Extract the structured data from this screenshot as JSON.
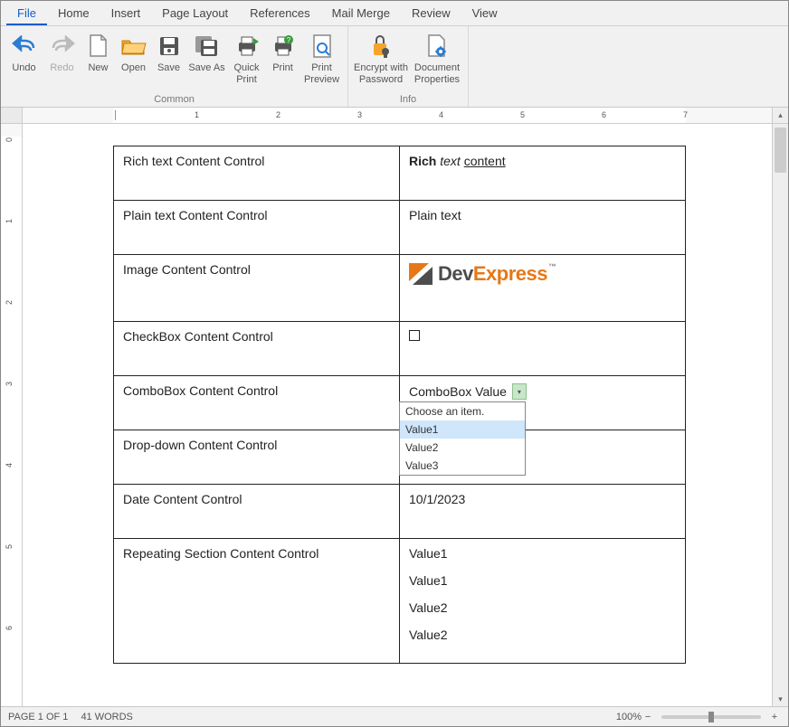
{
  "menu": {
    "tabs": [
      "File",
      "Home",
      "Insert",
      "Page Layout",
      "References",
      "Mail Merge",
      "Review",
      "View"
    ],
    "active_index": 0
  },
  "ribbon": {
    "groups": [
      {
        "label": "Common",
        "items": [
          {
            "name": "undo",
            "label": "Undo"
          },
          {
            "name": "redo",
            "label": "Redo"
          },
          {
            "name": "new",
            "label": "New"
          },
          {
            "name": "open",
            "label": "Open"
          },
          {
            "name": "save",
            "label": "Save"
          },
          {
            "name": "save-as",
            "label": "Save As"
          },
          {
            "name": "quick-print",
            "label": "Quick\nPrint"
          },
          {
            "name": "print",
            "label": "Print"
          },
          {
            "name": "print-preview",
            "label": "Print\nPreview"
          }
        ]
      },
      {
        "label": "Info",
        "items": [
          {
            "name": "encrypt",
            "label": "Encrypt with\nPassword"
          },
          {
            "name": "doc-props",
            "label": "Document\nProperties"
          }
        ]
      }
    ]
  },
  "ruler": {
    "h_marks": [
      "1",
      "2",
      "3",
      "4",
      "5",
      "6",
      "7"
    ],
    "v_marks": [
      "0",
      "1",
      "2",
      "3",
      "4",
      "5",
      "6"
    ]
  },
  "content": {
    "rows": [
      {
        "label": "Rich text Content Control",
        "value_html": true,
        "value_parts": {
          "bold": "Rich",
          "ital": "text",
          "und": "content"
        }
      },
      {
        "label": "Plain text Content Control",
        "value": "Plain text"
      },
      {
        "label": "Image Content Control",
        "value_logo": true,
        "logo_text_dark": "Dev",
        "logo_text_accent": "Express"
      },
      {
        "label": "CheckBox Content Control",
        "value_checkbox": true
      },
      {
        "label": "ComboBox Content Control",
        "value_combo": true,
        "combo_value": "ComboBox Value",
        "options": [
          "Choose an item.",
          "Value1",
          "Value2",
          "Value3"
        ],
        "selected_index": 1
      },
      {
        "label": "Drop-down Content Control",
        "value": ""
      },
      {
        "label": "Date Content Control",
        "value": "10/1/2023"
      },
      {
        "label": "Repeating Section Content Control",
        "value_repeat": true,
        "repeat_values": [
          "Value1",
          "Value1",
          "Value2",
          "Value2"
        ]
      }
    ]
  },
  "status": {
    "page": "PAGE 1 OF 1",
    "words": "41 WORDS",
    "zoom": "100%",
    "zoom_minus": "−",
    "zoom_plus": "+"
  }
}
